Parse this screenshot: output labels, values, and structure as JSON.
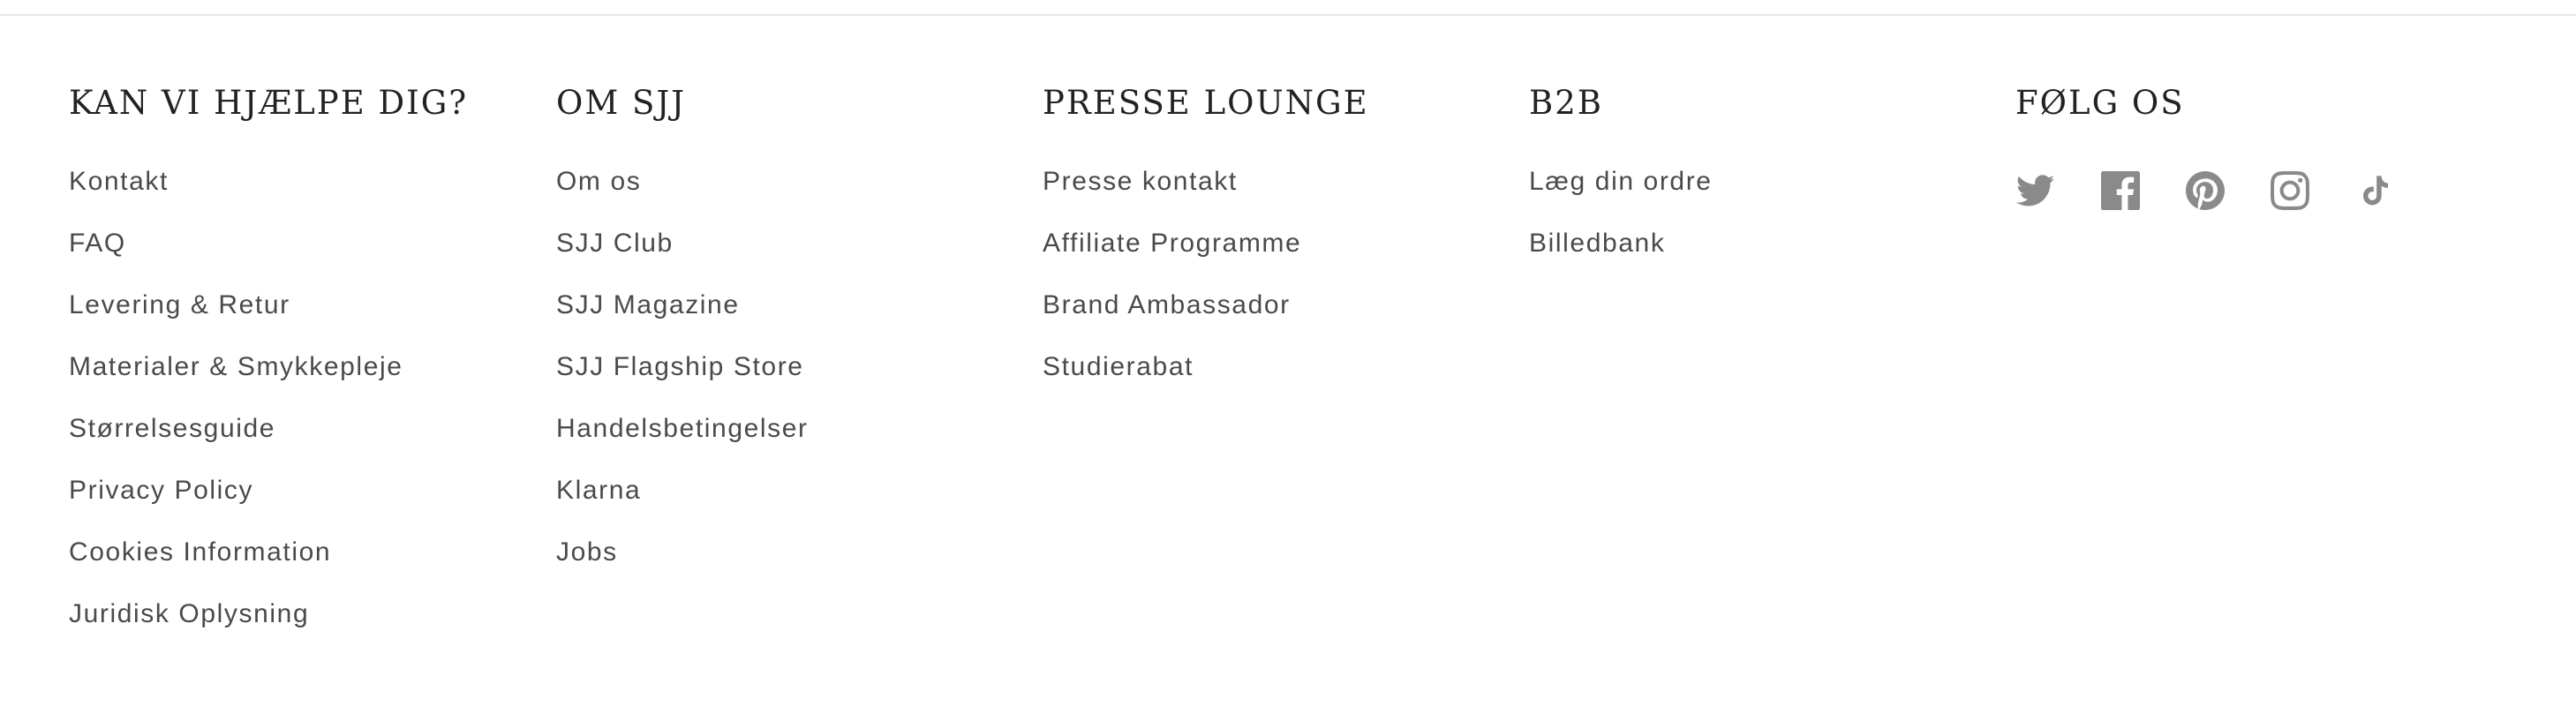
{
  "footer": {
    "help": {
      "heading": "KAN VI HJÆLPE DIG?",
      "links": [
        "Kontakt",
        "FAQ",
        "Levering & Retur",
        "Materialer & Smykkepleje",
        "Størrelsesguide",
        "Privacy Policy",
        "Cookies Information",
        "Juridisk Oplysning"
      ]
    },
    "about": {
      "heading": "OM SJJ",
      "links": [
        "Om os",
        "SJJ Club",
        "SJJ Magazine",
        "SJJ Flagship Store",
        "Handelsbetingelser",
        "Klarna",
        "Jobs"
      ]
    },
    "press": {
      "heading": "PRESSE LOUNGE",
      "links": [
        "Presse kontakt",
        "Affiliate Programme",
        "Brand Ambassador",
        "Studierabat"
      ]
    },
    "b2b": {
      "heading": "B2B",
      "links": [
        "Læg din ordre",
        "Billedbank"
      ]
    },
    "follow": {
      "heading": "FØLG OS",
      "icons": [
        "twitter-icon",
        "facebook-icon",
        "pinterest-icon",
        "instagram-icon",
        "tiktok-icon"
      ],
      "icon_color": "#8a8a8a"
    }
  },
  "colors": {
    "heading": "#222222",
    "link": "#4a4a4a",
    "divider": "#e8e8e8",
    "background": "#ffffff"
  }
}
